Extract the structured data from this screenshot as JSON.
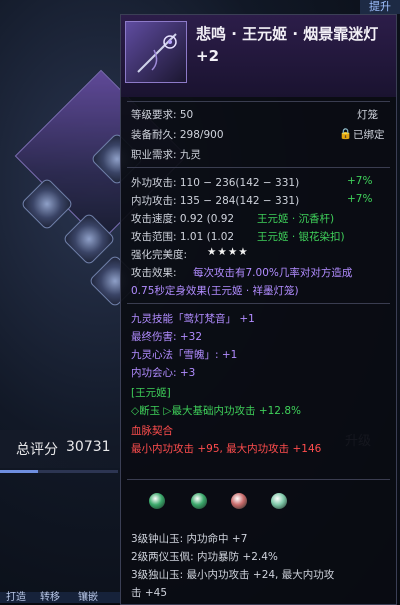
{
  "header": {
    "upgrade": "提升"
  },
  "item": {
    "title": "悲鸣 · 王元姬 · 烟景霏迷灯 +2",
    "level_label": "等级要求: 50",
    "type": "灯笼",
    "durability_label": "装备耐久: 298/900",
    "bind_status": "已绑定",
    "class_label": "职业需求: 九灵"
  },
  "stats": {
    "outer_attack": "外功攻击: 110 − 236(142 − 331)",
    "outer_attack_bonus": "+7%",
    "inner_attack": "内功攻击: 135 − 284(142 − 331)",
    "inner_attack_bonus": "+7%",
    "attack_speed": "攻击速度: 0.92 (0.92",
    "attack_speed_src": "王元姬 · 沉香杆)",
    "attack_range": "攻击范围: 1.01 (1.02",
    "attack_range_src": "王元姬 · 银花染扣)",
    "refine_label": "强化完美度:",
    "refine_stars": "★★★★",
    "attack_effect_label": "攻击效果:",
    "attack_effect_line1": "每次攻击有7.00%几率对对方造成",
    "attack_effect_line2": "0.75秒定身效果(王元姬 · 祥墨灯笼)"
  },
  "attributes": [
    {
      "text": "九灵技能「莺灯梵音」 +1",
      "color": "purple"
    },
    {
      "text": "最终伤害: +32",
      "color": "purple"
    },
    {
      "text": "九灵心法「雪魄」: +1",
      "color": "purple"
    },
    {
      "text": "内功会心: +3",
      "color": "purple"
    },
    {
      "text": "[王元姬]",
      "color": "green"
    },
    {
      "text": "◇断玉 ▷最大基础内功攻击 +12.8%",
      "color": "green"
    },
    {
      "text": "血脉契合",
      "color": "red"
    },
    {
      "text": "最小内功攻击 +95,  最大内功攻击 +146",
      "color": "red"
    }
  ],
  "gems": {
    "colors": [
      "#3aa86a",
      "#3aa86a",
      "#c86a6a",
      "#7ec8a8"
    ],
    "lines": [
      "3级钟山玉: 内功命中 +7",
      "2级两仪玉佩: 内功暴防 +2.4%",
      "3级独山玉: 最小内功攻击 +24, 最大内功攻",
      "击 +45"
    ]
  },
  "left_panel": {
    "score_label": "总评分",
    "score_value": "30731",
    "upgrade_button": "升级",
    "progress": 0.32,
    "tabs": [
      "打造",
      "转移",
      "镶嵌"
    ]
  }
}
